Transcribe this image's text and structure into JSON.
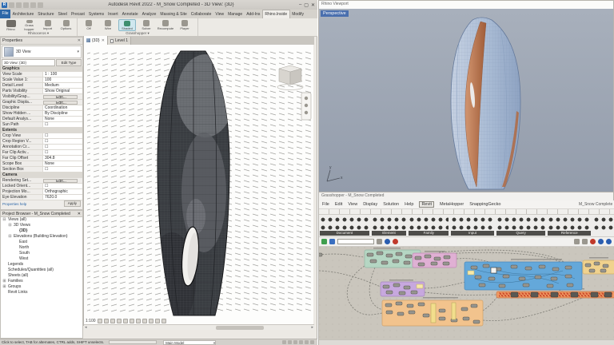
{
  "colors": {
    "revit_accent_blue": "#2d67a8",
    "shaded_active": "#cfe7ee",
    "rhino_selection_blue": "#4a6fae",
    "tower_dark": "#3a3d42",
    "tower_blue": "#a9bbd4",
    "tower_copper": "#b06a42",
    "gh_group_teal": "#b5d6c3",
    "gh_group_pink": "#e2aed6",
    "gh_group_blue": "#64a8da",
    "gh_group_purple": "#c7a8de",
    "gh_group_orange": "#f2c38d",
    "gh_group_yellow": "#f0d28e",
    "gh_group_redstrip": "#ef9a62"
  },
  "revit": {
    "title": "Autodesk Revit 2022 - M_Snow Completed - 3D View: {3D}",
    "window_buttons": [
      "–",
      "▢",
      "✕"
    ],
    "tabs": [
      "File",
      "Architecture",
      "Structure",
      "Steel",
      "Precast",
      "Systems",
      "Insert",
      "Annotate",
      "Analyze",
      "Massing & Site",
      "Collaborate",
      "View",
      "Manage",
      "Add-Ins",
      "Rhino.Inside",
      "Modify"
    ],
    "active_tab": "Rhino.Inside",
    "ribbon": {
      "panel1_label": "Rhinoceros ▾",
      "panel1_buttons": [
        "Rhino",
        "Grass hopper",
        "Import",
        "Options"
      ],
      "panel2_label": "Grasshopper ▾",
      "panel2_buttons": [
        "Off",
        "Wire",
        "Shaded",
        "Solver",
        "Recompute",
        "Player"
      ],
      "active_button": "Shaded"
    },
    "view_tabs": [
      {
        "label": "{3D}",
        "close": "✕"
      },
      {
        "label": "Level 1",
        "close": ""
      }
    ],
    "properties": {
      "header": "Properties",
      "pin": "📌",
      "type_selector": "3D View",
      "instance_selector": "3D View: {3D}",
      "edit_type": "Edit Type",
      "rows": [
        {
          "label": "Graphics",
          "value": ""
        },
        {
          "label": "View Scale",
          "value": "1 : 100"
        },
        {
          "label": "Scale Value 1:",
          "value": "100"
        },
        {
          "label": "Detail Level",
          "value": "Medium"
        },
        {
          "label": "Parts Visibility",
          "value": "Show Original"
        },
        {
          "label": "Visibility/Grap...",
          "value": "Edit..."
        },
        {
          "label": "Graphic Displa...",
          "value": "Edit..."
        },
        {
          "label": "Discipline",
          "value": "Coordination"
        },
        {
          "label": "Show Hidden ...",
          "value": "By Discipline"
        },
        {
          "label": "Default Analys...",
          "value": "None"
        },
        {
          "label": "Sun Path",
          "value": "☐"
        },
        {
          "label": "Extents",
          "value": ""
        },
        {
          "label": "Crop View",
          "value": "☐"
        },
        {
          "label": "Crop Region V...",
          "value": "☐"
        },
        {
          "label": "Annotation Cr...",
          "value": "☐"
        },
        {
          "label": "Far Clip Activ...",
          "value": "☐"
        },
        {
          "label": "Far Clip Offset",
          "value": "304.8"
        },
        {
          "label": "Scope Box",
          "value": "None"
        },
        {
          "label": "Section Box",
          "value": "☐"
        },
        {
          "label": "Camera",
          "value": ""
        },
        {
          "label": "Rendering Set...",
          "value": "Edit..."
        },
        {
          "label": "Locked Orient...",
          "value": "☐"
        },
        {
          "label": "Projection Mo...",
          "value": "Orthographic"
        },
        {
          "label": "Eye Elevation",
          "value": "7620.0"
        }
      ],
      "help_link": "Properties help",
      "apply_button": "Apply"
    },
    "project_browser": {
      "header": "Project Browser - M_Snow Completed",
      "close": "✕",
      "items": [
        {
          "label": "Views (all)",
          "glyph": "⊟"
        },
        {
          "label": "3D Views",
          "glyph": "⊟"
        },
        {
          "label": "{3D}",
          "glyph": ""
        },
        {
          "label": "Elevations (Building Elevation)",
          "glyph": "⊟"
        },
        {
          "label": "East",
          "glyph": ""
        },
        {
          "label": "North",
          "glyph": ""
        },
        {
          "label": "South",
          "glyph": ""
        },
        {
          "label": "West",
          "glyph": ""
        },
        {
          "label": "Legends",
          "glyph": ""
        },
        {
          "label": "Schedules/Quantities (all)",
          "glyph": ""
        },
        {
          "label": "Sheets (all)",
          "glyph": ""
        },
        {
          "label": "Families",
          "glyph": "⊞"
        },
        {
          "label": "Groups",
          "glyph": "⊞"
        },
        {
          "label": "Revit Links",
          "glyph": ""
        }
      ]
    },
    "view_control_bar": {
      "scale": "1:100"
    },
    "status_bar": {
      "hint": "Click to select, TAB for alternates, CTRL adds, SHIFT unselects.",
      "workset": "Main Model",
      "dropdown_arrow": "▾"
    }
  },
  "rhino": {
    "window_title": "Rhino Viewport",
    "viewport_label": "Perspective",
    "axis_x": "x",
    "axis_y": "y"
  },
  "grasshopper": {
    "window_title": "Grasshopper - M_Snow Completed",
    "menus": [
      "File",
      "Edit",
      "View",
      "Display",
      "Solution",
      "Help",
      "Revit",
      "MetaHopper",
      "SnappingGecko"
    ],
    "active_menu": "Revit",
    "doc_selector": "M_Snow Completed",
    "panel_labels": [
      "Document",
      "Element",
      "Family",
      "Input",
      "Query",
      "Reference"
    ]
  }
}
